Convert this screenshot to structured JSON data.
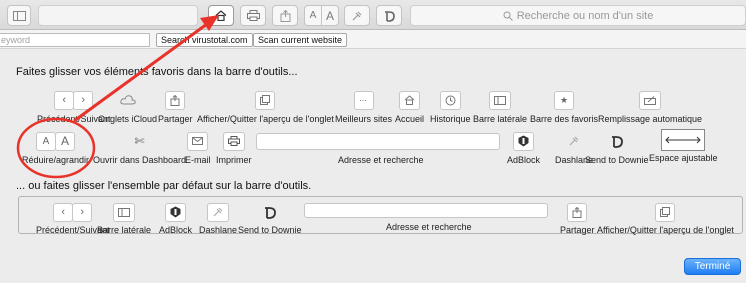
{
  "toolbar": {
    "search_placeholder": "Recherche ou nom d'un site",
    "size_small": "A",
    "size_large": "A",
    "icons": [
      "sidebar-icon",
      "home-icon",
      "print-icon",
      "share-icon",
      "text-size-icon",
      "dashlane-icon",
      "send-to-downie-icon",
      "search-icon"
    ]
  },
  "bookmarks_bar": {
    "input_value": "eyword",
    "search_button": "Search virustotal.com",
    "scan_button": "Scan current website"
  },
  "palette": {
    "heading": "Faites glisser vos éléments favoris dans la barre d'outils...",
    "row1": [
      {
        "label": "Précédent/Suivant",
        "icon": "back-forward-icon"
      },
      {
        "label": "Onglets iCloud",
        "icon": "cloud-icon"
      },
      {
        "label": "Partager",
        "icon": "share-icon"
      },
      {
        "label": "Afficher/Quitter l'aperçu de l'onglet",
        "icon": "tab-overview-icon"
      },
      {
        "label": "Meilleurs sites",
        "icon": "top-sites-icon"
      },
      {
        "label": "Accueil",
        "icon": "home-icon"
      },
      {
        "label": "Historique",
        "icon": "history-icon"
      },
      {
        "label": "Barre latérale",
        "icon": "sidebar-icon"
      },
      {
        "label": "Barre des favoris",
        "icon": "favorites-bar-icon"
      },
      {
        "label": "Remplissage automatique",
        "icon": "autofill-icon"
      }
    ],
    "row2": [
      {
        "label": "Réduire/agrandir",
        "icon": "text-size-icon",
        "glyphs": [
          "A",
          "A"
        ]
      },
      {
        "label": "Ouvrir dans Dashboard",
        "icon": "dashboard-icon"
      },
      {
        "label": "E-mail",
        "icon": "mail-icon"
      },
      {
        "label": "Imprimer",
        "icon": "print-icon"
      },
      {
        "label": "Adresse et recherche",
        "icon": "address-bar"
      },
      {
        "label": "AdBlock",
        "icon": "adblock-icon"
      },
      {
        "label": "Dashlane",
        "icon": "dashlane-icon"
      },
      {
        "label": "Send to Downie",
        "icon": "send-to-downie-icon"
      },
      {
        "label": "Espace ajustable",
        "icon": "flexible-space-icon"
      }
    ]
  },
  "default_set": {
    "heading": "... ou faites glisser l'ensemble par défaut sur la barre d'outils.",
    "items": [
      {
        "label": "Précédent/Suivant"
      },
      {
        "label": "Barre latérale"
      },
      {
        "label": "AdBlock"
      },
      {
        "label": "Dashlane"
      },
      {
        "label": "Send to Downie"
      },
      {
        "label": "Adresse et recherche"
      },
      {
        "label": "Partager"
      },
      {
        "label": "Afficher/Quitter l'aperçu de l'onglet"
      }
    ]
  },
  "done_button": "Terminé",
  "annotation": {
    "color": "#e8322a"
  }
}
